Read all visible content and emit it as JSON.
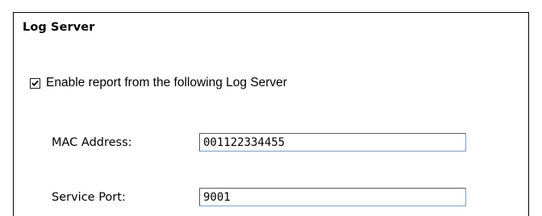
{
  "log_server": {
    "title": "Log Server",
    "enable_report": {
      "label": "Enable report from the following Log Server",
      "checked": true
    },
    "mac_address": {
      "label": "MAC Address:",
      "value": "001122334455"
    },
    "service_port": {
      "label": "Service Port:",
      "value": "9001"
    }
  }
}
